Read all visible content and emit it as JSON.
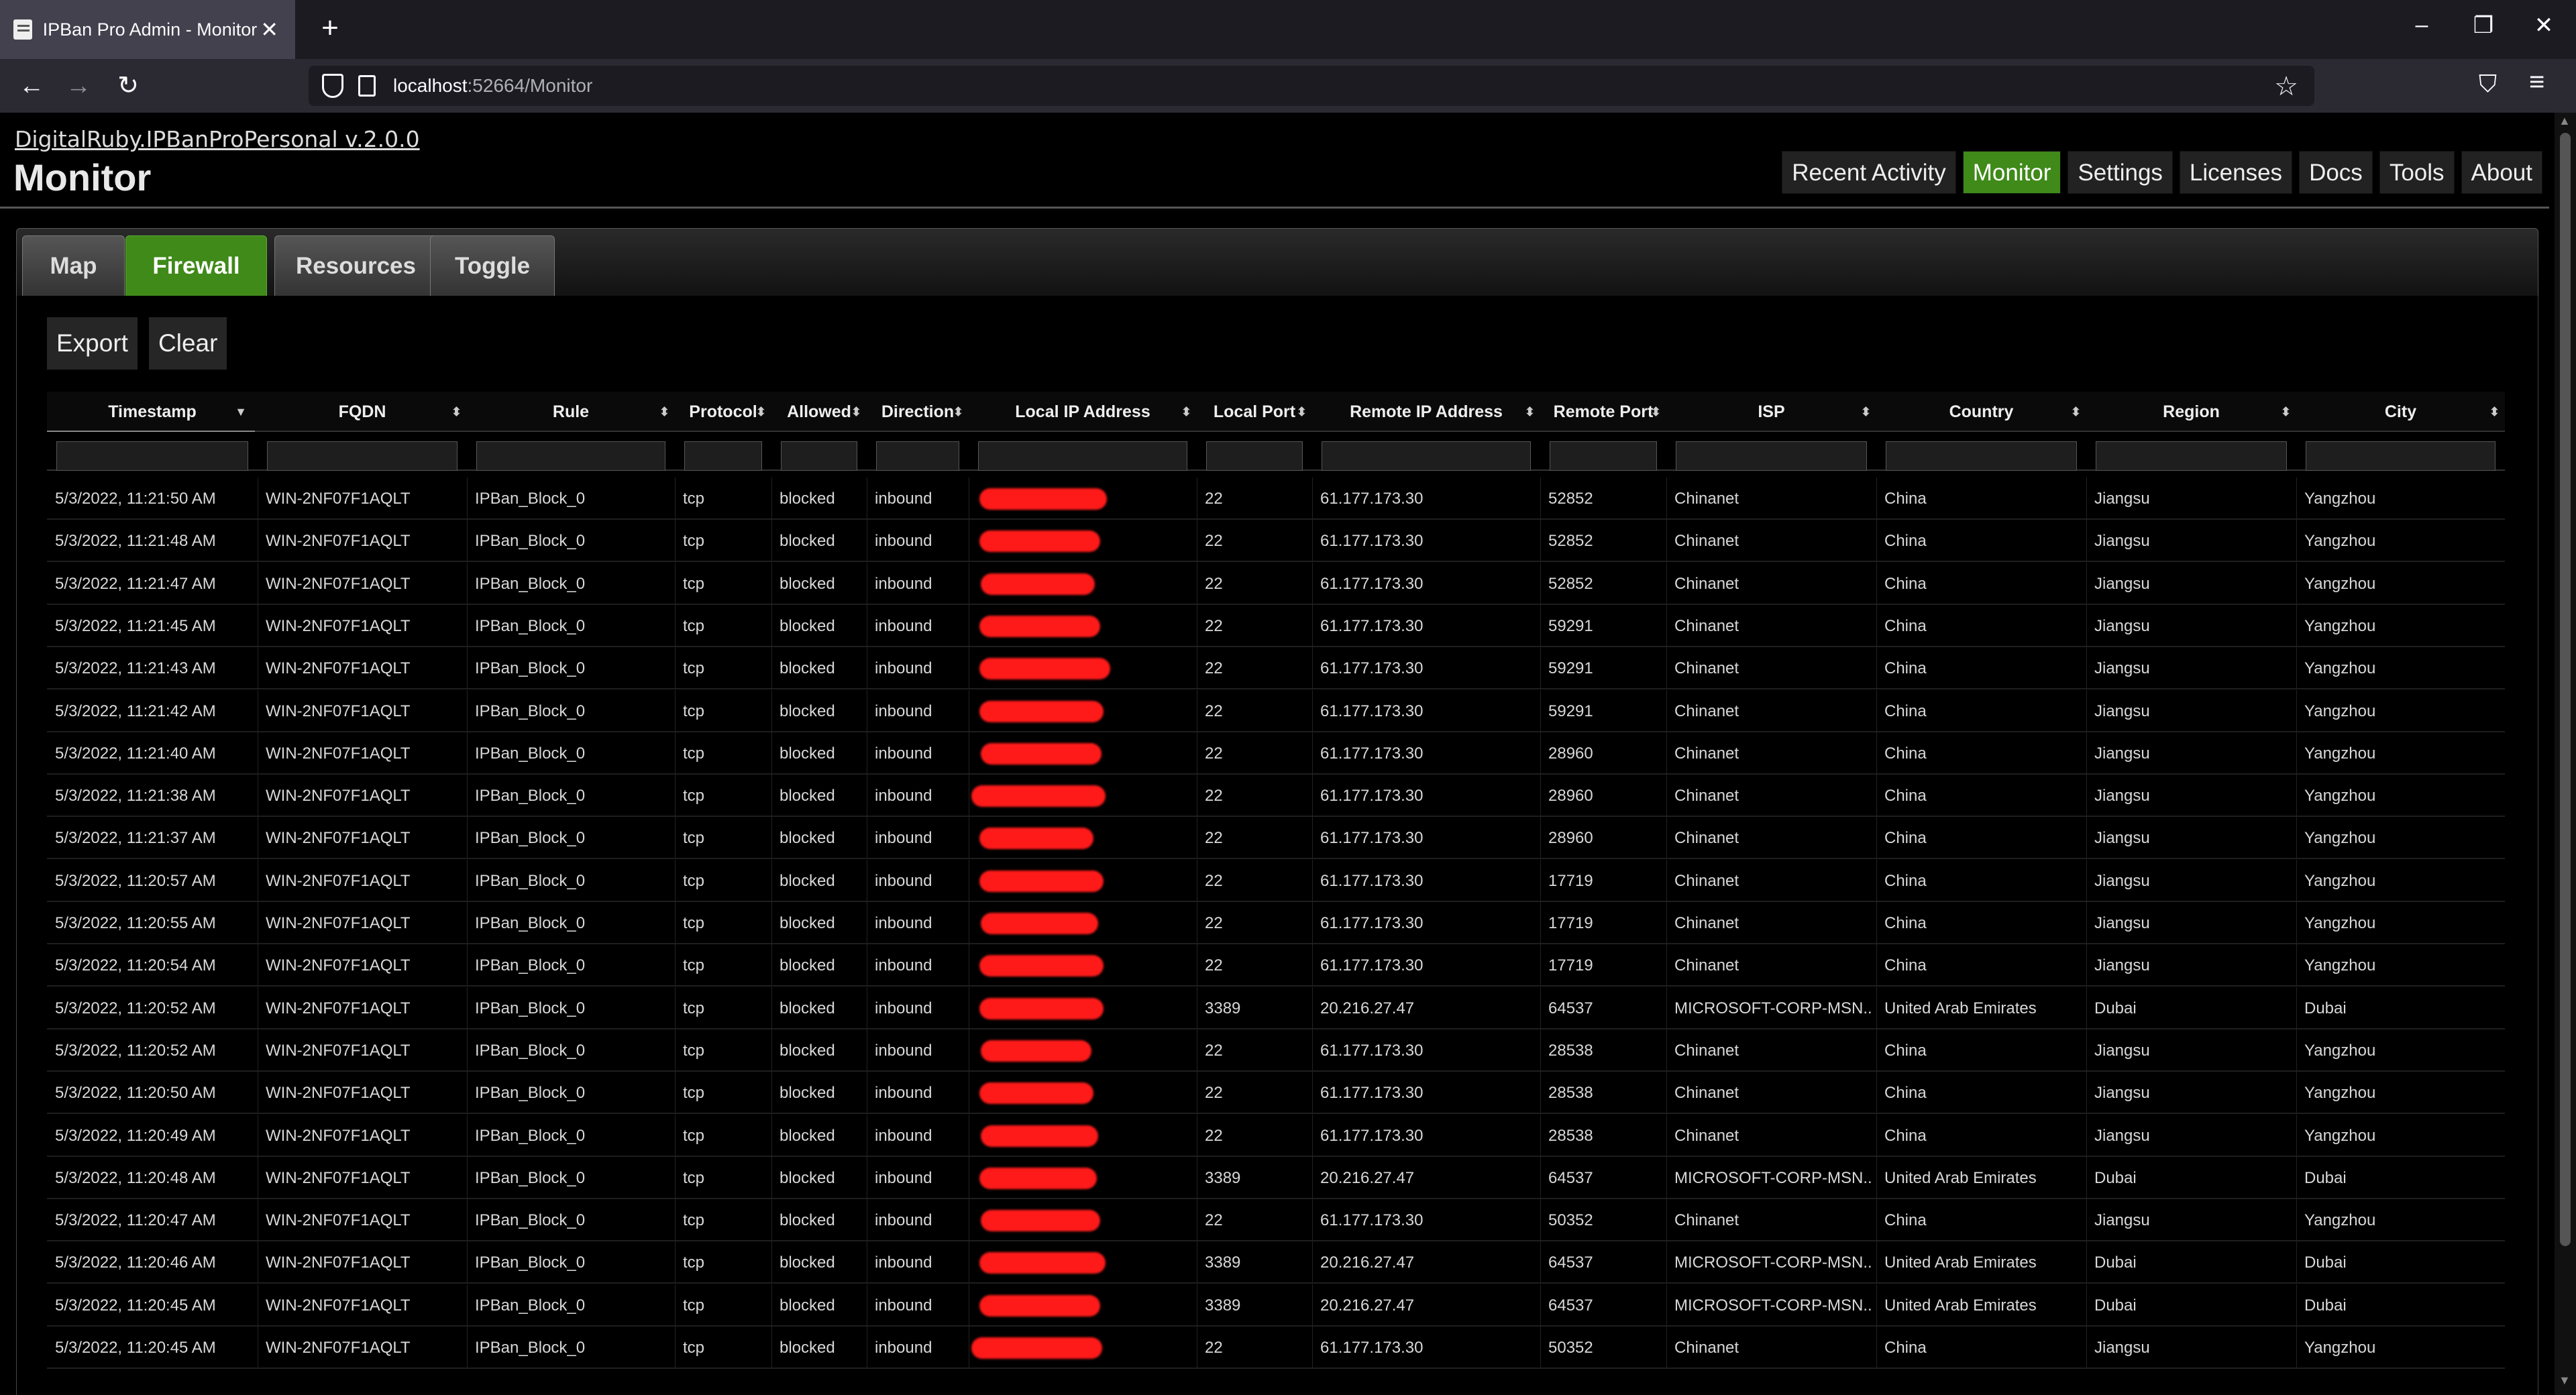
{
  "browser": {
    "tab_title": "IPBan Pro Admin - Monitor",
    "tab_close": "✕",
    "new_tab": "+",
    "url_host": "localhost",
    "url_rest": ":52664/Monitor",
    "win_min": "–",
    "win_restore": "❐",
    "win_close": "✕",
    "back": "←",
    "forward": "→",
    "reload": "↻",
    "star": "☆",
    "pocket": "⛉",
    "menu": "≡"
  },
  "header": {
    "app_link": "DigitalRuby.IPBanProPersonal v.2.0.0",
    "title": "Monitor",
    "nav": [
      "Recent Activity",
      "Monitor",
      "Settings",
      "Licenses",
      "Docs",
      "Tools",
      "About"
    ],
    "active_nav": "Monitor"
  },
  "panel_tabs": [
    "Map",
    "Firewall",
    "Resources",
    "Toggle"
  ],
  "active_panel_tab": "Firewall",
  "actions": {
    "export": "Export",
    "clear": "Clear"
  },
  "table": {
    "columns": [
      "Timestamp",
      "FQDN",
      "Rule",
      "Protocol",
      "Allowed",
      "Direction",
      "Local IP Address",
      "Local Port",
      "Remote IP Address",
      "Remote Port",
      "ISP",
      "Country",
      "Region",
      "City"
    ],
    "rows": [
      [
        "5/3/2022, 11:21:50 AM",
        "WIN-2NF07F1AQLT",
        "IPBan_Block_0",
        "tcp",
        "blocked",
        "inbound",
        "",
        "22",
        "61.177.173.30",
        "52852",
        "Chinanet",
        "China",
        "Jiangsu",
        "Yangzhou"
      ],
      [
        "5/3/2022, 11:21:48 AM",
        "WIN-2NF07F1AQLT",
        "IPBan_Block_0",
        "tcp",
        "blocked",
        "inbound",
        "",
        "22",
        "61.177.173.30",
        "52852",
        "Chinanet",
        "China",
        "Jiangsu",
        "Yangzhou"
      ],
      [
        "5/3/2022, 11:21:47 AM",
        "WIN-2NF07F1AQLT",
        "IPBan_Block_0",
        "tcp",
        "blocked",
        "inbound",
        "",
        "22",
        "61.177.173.30",
        "52852",
        "Chinanet",
        "China",
        "Jiangsu",
        "Yangzhou"
      ],
      [
        "5/3/2022, 11:21:45 AM",
        "WIN-2NF07F1AQLT",
        "IPBan_Block_0",
        "tcp",
        "blocked",
        "inbound",
        "",
        "22",
        "61.177.173.30",
        "59291",
        "Chinanet",
        "China",
        "Jiangsu",
        "Yangzhou"
      ],
      [
        "5/3/2022, 11:21:43 AM",
        "WIN-2NF07F1AQLT",
        "IPBan_Block_0",
        "tcp",
        "blocked",
        "inbound",
        "",
        "22",
        "61.177.173.30",
        "59291",
        "Chinanet",
        "China",
        "Jiangsu",
        "Yangzhou"
      ],
      [
        "5/3/2022, 11:21:42 AM",
        "WIN-2NF07F1AQLT",
        "IPBan_Block_0",
        "tcp",
        "blocked",
        "inbound",
        "",
        "22",
        "61.177.173.30",
        "59291",
        "Chinanet",
        "China",
        "Jiangsu",
        "Yangzhou"
      ],
      [
        "5/3/2022, 11:21:40 AM",
        "WIN-2NF07F1AQLT",
        "IPBan_Block_0",
        "tcp",
        "blocked",
        "inbound",
        "",
        "22",
        "61.177.173.30",
        "28960",
        "Chinanet",
        "China",
        "Jiangsu",
        "Yangzhou"
      ],
      [
        "5/3/2022, 11:21:38 AM",
        "WIN-2NF07F1AQLT",
        "IPBan_Block_0",
        "tcp",
        "blocked",
        "inbound",
        "",
        "22",
        "61.177.173.30",
        "28960",
        "Chinanet",
        "China",
        "Jiangsu",
        "Yangzhou"
      ],
      [
        "5/3/2022, 11:21:37 AM",
        "WIN-2NF07F1AQLT",
        "IPBan_Block_0",
        "tcp",
        "blocked",
        "inbound",
        "",
        "22",
        "61.177.173.30",
        "28960",
        "Chinanet",
        "China",
        "Jiangsu",
        "Yangzhou"
      ],
      [
        "5/3/2022, 11:20:57 AM",
        "WIN-2NF07F1AQLT",
        "IPBan_Block_0",
        "tcp",
        "blocked",
        "inbound",
        "",
        "22",
        "61.177.173.30",
        "17719",
        "Chinanet",
        "China",
        "Jiangsu",
        "Yangzhou"
      ],
      [
        "5/3/2022, 11:20:55 AM",
        "WIN-2NF07F1AQLT",
        "IPBan_Block_0",
        "tcp",
        "blocked",
        "inbound",
        "",
        "22",
        "61.177.173.30",
        "17719",
        "Chinanet",
        "China",
        "Jiangsu",
        "Yangzhou"
      ],
      [
        "5/3/2022, 11:20:54 AM",
        "WIN-2NF07F1AQLT",
        "IPBan_Block_0",
        "tcp",
        "blocked",
        "inbound",
        "",
        "22",
        "61.177.173.30",
        "17719",
        "Chinanet",
        "China",
        "Jiangsu",
        "Yangzhou"
      ],
      [
        "5/3/2022, 11:20:52 AM",
        "WIN-2NF07F1AQLT",
        "IPBan_Block_0",
        "tcp",
        "blocked",
        "inbound",
        "",
        "3389",
        "20.216.27.47",
        "64537",
        "MICROSOFT-CORP-MSN...",
        "United Arab Emirates",
        "Dubai",
        "Dubai"
      ],
      [
        "5/3/2022, 11:20:52 AM",
        "WIN-2NF07F1AQLT",
        "IPBan_Block_0",
        "tcp",
        "blocked",
        "inbound",
        "",
        "22",
        "61.177.173.30",
        "28538",
        "Chinanet",
        "China",
        "Jiangsu",
        "Yangzhou"
      ],
      [
        "5/3/2022, 11:20:50 AM",
        "WIN-2NF07F1AQLT",
        "IPBan_Block_0",
        "tcp",
        "blocked",
        "inbound",
        "",
        "22",
        "61.177.173.30",
        "28538",
        "Chinanet",
        "China",
        "Jiangsu",
        "Yangzhou"
      ],
      [
        "5/3/2022, 11:20:49 AM",
        "WIN-2NF07F1AQLT",
        "IPBan_Block_0",
        "tcp",
        "blocked",
        "inbound",
        "",
        "22",
        "61.177.173.30",
        "28538",
        "Chinanet",
        "China",
        "Jiangsu",
        "Yangzhou"
      ],
      [
        "5/3/2022, 11:20:48 AM",
        "WIN-2NF07F1AQLT",
        "IPBan_Block_0",
        "tcp",
        "blocked",
        "inbound",
        "",
        "3389",
        "20.216.27.47",
        "64537",
        "MICROSOFT-CORP-MSN...",
        "United Arab Emirates",
        "Dubai",
        "Dubai"
      ],
      [
        "5/3/2022, 11:20:47 AM",
        "WIN-2NF07F1AQLT",
        "IPBan_Block_0",
        "tcp",
        "blocked",
        "inbound",
        "",
        "22",
        "61.177.173.30",
        "50352",
        "Chinanet",
        "China",
        "Jiangsu",
        "Yangzhou"
      ],
      [
        "5/3/2022, 11:20:46 AM",
        "WIN-2NF07F1AQLT",
        "IPBan_Block_0",
        "tcp",
        "blocked",
        "inbound",
        "",
        "3389",
        "20.216.27.47",
        "64537",
        "MICROSOFT-CORP-MSN...",
        "United Arab Emirates",
        "Dubai",
        "Dubai"
      ],
      [
        "5/3/2022, 11:20:45 AM",
        "WIN-2NF07F1AQLT",
        "IPBan_Block_0",
        "tcp",
        "blocked",
        "inbound",
        "",
        "3389",
        "20.216.27.47",
        "64537",
        "MICROSOFT-CORP-MSN...",
        "United Arab Emirates",
        "Dubai",
        "Dubai"
      ],
      [
        "5/3/2022, 11:20:45 AM",
        "WIN-2NF07F1AQLT",
        "IPBan_Block_0",
        "tcp",
        "blocked",
        "inbound",
        "",
        "22",
        "61.177.173.30",
        "50352",
        "Chinanet",
        "China",
        "Jiangsu",
        "Yangzhou"
      ]
    ],
    "redaction_color": "#ff1a1a"
  },
  "colors": {
    "accent": "#3f8a19",
    "background": "#000000"
  }
}
